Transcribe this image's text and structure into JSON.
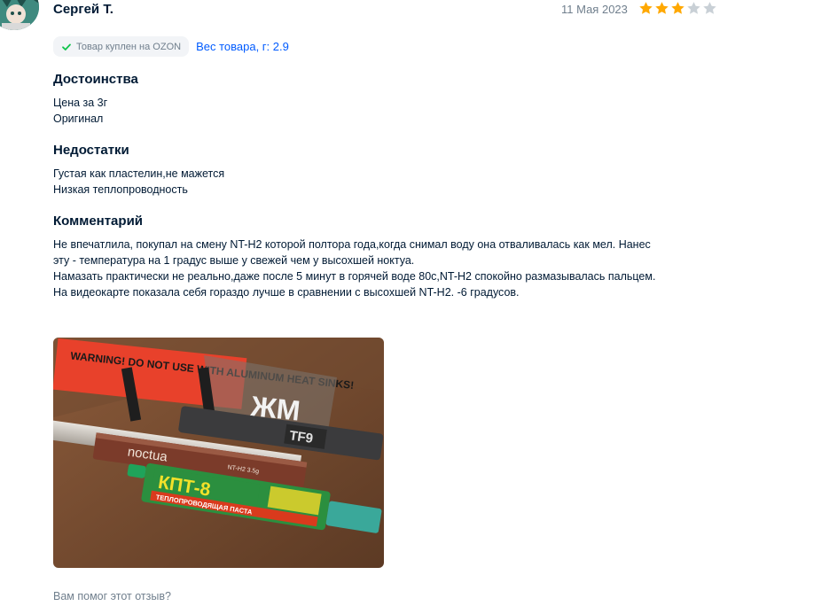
{
  "review": {
    "author": "Сергей Т.",
    "date": "11 Мая 2023",
    "rating": 3,
    "rating_max": 5,
    "badge": {
      "icon": "checkmark-icon",
      "label": "Товар куплен на OZON"
    },
    "variant_link": "Вес товара, г: 2.9",
    "pros": {
      "title": "Достоинства",
      "lines": [
        "Цена за 3г",
        "Оригинал"
      ]
    },
    "cons": {
      "title": "Недостатки",
      "lines": [
        "Густая как пластелин,не мажется",
        "Низкая теплопроводность"
      ]
    },
    "comment": {
      "title": "Комментарий",
      "lines": [
        "Не впечатлила, покупал на смену NT-H2 которой полтора года,когда снимал воду она отваливалась как мел. Нанес",
        "эту - температура на 1 градус выше у свежей чем у высохшей ноктуа.",
        "Намазать практически не реально,даже после 5 минут в горячей воде 80с,NT-H2 спокойно размазывалась пальцем.",
        "На видеокарте показала себя гораздо лучше в сравнении с высохшей NT-H2. -6 градусов."
      ]
    },
    "photo": {
      "label_warning": "WARNING! DO NOT USE WITH ALUMINUM HEAT SINKS!",
      "label_marker": "ЖМ",
      "label_tf9": "TF9",
      "label_noctua": "noctua",
      "label_nth2": "NT-H2 3.5g",
      "label_kpt": "КПТ-8",
      "label_kpt_sub": "ТЕПЛОПРОВОДЯЩАЯ ПАСТА"
    },
    "helpful_question": "Вам помог этот отзыв?"
  },
  "colors": {
    "star_filled": "#ffa800",
    "star_empty": "#c9d0d6",
    "link": "#005bff",
    "badge_check": "#10c44c"
  }
}
